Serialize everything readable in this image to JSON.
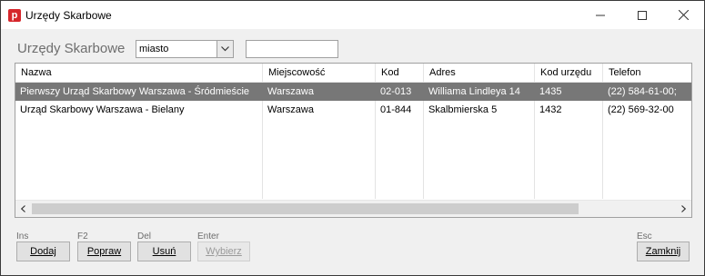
{
  "window": {
    "title": "Urzędy Skarbowe",
    "app_icon_letter": "p"
  },
  "filter": {
    "section_title": "Urzędy Skarbowe",
    "field_selected": "miasto",
    "search_value": "",
    "search_placeholder": ""
  },
  "table": {
    "columns": [
      "Nazwa",
      "Miejscowość",
      "Kod",
      "Adres",
      "Kod urzędu",
      "Telefon"
    ],
    "rows": [
      [
        "Pierwszy Urząd Skarbowy Warszawa - Śródmieście",
        "Warszawa",
        "02-013",
        "Williama Lindleya 14",
        "1435",
        "(22) 584-61-00;"
      ],
      [
        "Urząd Skarbowy Warszawa - Bielany",
        "Warszawa",
        "01-844",
        "Skalbmierska 5",
        "1432",
        "(22) 569-32-00"
      ]
    ],
    "selected_row": 0,
    "selected_row_color": "#777777"
  },
  "buttons": {
    "add": {
      "key": "Ins",
      "label": "Dodaj"
    },
    "edit": {
      "key": "F2",
      "label": "Popraw"
    },
    "delete": {
      "key": "Del",
      "label": "Usuń"
    },
    "select": {
      "key": "Enter",
      "label": "Wybierz"
    },
    "close": {
      "key": "Esc",
      "label": "Zamknij"
    }
  },
  "icons": {
    "app": "app-icon",
    "minimize": "minimize-icon",
    "maximize": "maximize-icon",
    "close": "close-icon",
    "dropdown": "chevron-down-icon",
    "scroll_left": "chevron-left-icon",
    "scroll_right": "chevron-right-icon"
  },
  "colors": {
    "accent": "#d6262b"
  }
}
